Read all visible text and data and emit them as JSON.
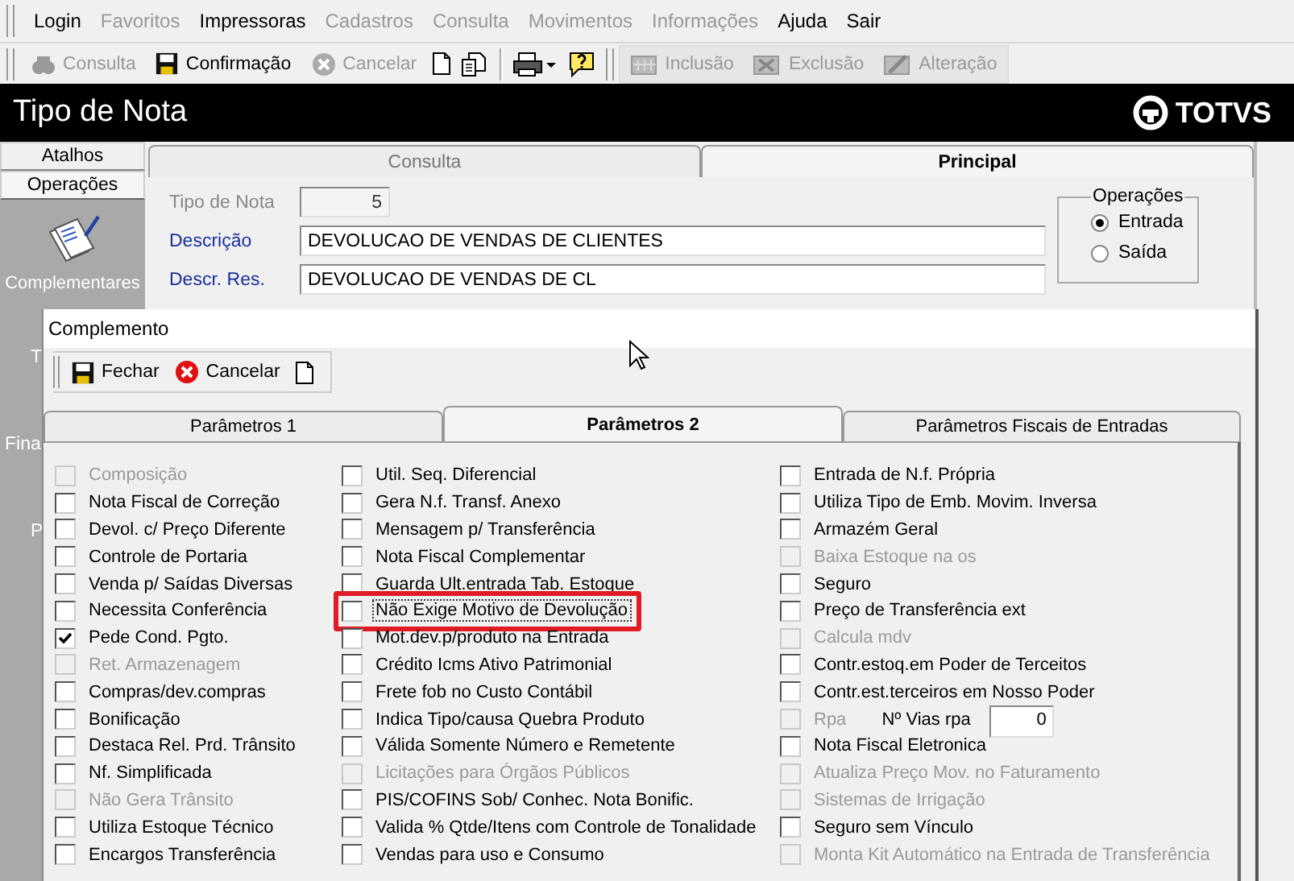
{
  "menu": [
    {
      "label": "Login",
      "disabled": false
    },
    {
      "label": "Favoritos",
      "disabled": true
    },
    {
      "label": "Impressoras",
      "disabled": false
    },
    {
      "label": "Cadastros",
      "disabled": true
    },
    {
      "label": "Consulta",
      "disabled": true
    },
    {
      "label": "Movimentos",
      "disabled": true
    },
    {
      "label": "Informações",
      "disabled": true
    },
    {
      "label": "Ajuda",
      "disabled": false
    },
    {
      "label": "Sair",
      "disabled": false
    }
  ],
  "toolbar": [
    {
      "kind": "button",
      "label": "Consulta",
      "disabled": true
    },
    {
      "kind": "button",
      "label": "Confirmação",
      "disabled": false
    },
    {
      "kind": "button",
      "label": "Cancelar",
      "disabled": true
    },
    {
      "kind": "icon"
    },
    {
      "kind": "icon"
    },
    {
      "kind": "separator"
    },
    {
      "kind": "icon"
    },
    {
      "kind": "icon"
    },
    {
      "kind": "separator"
    },
    {
      "kind": "button",
      "label": "Inclusão",
      "disabled": true
    },
    {
      "kind": "button",
      "label": "Exclusão",
      "disabled": true
    },
    {
      "kind": "button",
      "label": "Alteração",
      "disabled": true
    }
  ],
  "window": {
    "title": "Tipo de Nota",
    "logo": "TOTVS"
  },
  "sidebar": {
    "tabs": [
      {
        "label": "Atalhos",
        "selected": false
      },
      {
        "label": "Operações",
        "selected": true
      }
    ],
    "items": [
      {
        "kind": "icon_item",
        "label": "Complementares"
      },
      {
        "kind": "text",
        "label": "T"
      },
      {
        "kind": "text",
        "label": "Fina"
      },
      {
        "kind": "text",
        "label": "P"
      }
    ]
  },
  "main_tabs": [
    {
      "label": "Consulta",
      "selected": false
    },
    {
      "label": "Principal",
      "selected": true
    }
  ],
  "form": {
    "fields": [
      {
        "label": "Tipo de Nota",
        "value": "5",
        "disabled": true
      },
      {
        "label": "Descrição",
        "value": "DEVOLUCAO DE VENDAS DE CLIENTES",
        "disabled": false
      },
      {
        "label": "Descr. Res.",
        "value": "DEVOLUCAO DE VENDAS DE CL",
        "disabled": false
      }
    ],
    "operations": {
      "title": "Operações",
      "options": [
        {
          "label": "Entrada",
          "selected": true
        },
        {
          "label": "Saída",
          "selected": false
        }
      ]
    }
  },
  "dialog": {
    "title": "Complemento",
    "toolbar": [
      "Fechar",
      "Cancelar"
    ],
    "tabs": [
      {
        "label": "Parâmetros 1",
        "selected": false
      },
      {
        "label": "Parâmetros 2",
        "selected": true
      },
      {
        "label": "Parâmetros Fiscais de Entradas",
        "selected": false
      }
    ],
    "columns": [
      [
        {
          "label": "Composição",
          "checked": false,
          "disabled": true
        },
        {
          "label": "Nota Fiscal de Correção",
          "checked": false,
          "disabled": false
        },
        {
          "label": "Devol. c/ Preço Diferente",
          "checked": false,
          "disabled": false
        },
        {
          "label": "Controle de Portaria",
          "checked": false,
          "disabled": false
        },
        {
          "label": "Venda p/ Saídas Diversas",
          "checked": false,
          "disabled": false
        },
        {
          "label": "Necessita Conferência",
          "checked": false,
          "disabled": false
        },
        {
          "label": "Pede Cond. Pgto.",
          "checked": true,
          "disabled": false
        },
        {
          "label": "Ret. Armazenagem",
          "checked": false,
          "disabled": true
        },
        {
          "label": "Compras/dev.compras",
          "checked": false,
          "disabled": false
        },
        {
          "label": "Bonificação",
          "checked": false,
          "disabled": false
        },
        {
          "label": "Destaca Rel. Prd. Trânsito",
          "checked": false,
          "disabled": false
        },
        {
          "label": "Nf. Simplificada",
          "checked": false,
          "disabled": false
        },
        {
          "label": "Não Gera Trânsito",
          "checked": false,
          "disabled": true
        },
        {
          "label": "Utiliza Estoque Técnico",
          "checked": false,
          "disabled": false
        },
        {
          "label": "Encargos Transferência",
          "checked": false,
          "disabled": false
        }
      ],
      [
        {
          "label": "Util. Seq. Diferencial",
          "checked": false,
          "disabled": false
        },
        {
          "label": "Gera N.f. Transf. Anexo",
          "checked": false,
          "disabled": false
        },
        {
          "label": "Mensagem p/ Transferência",
          "checked": false,
          "disabled": false
        },
        {
          "label": "Nota Fiscal Complementar",
          "checked": false,
          "disabled": false
        },
        {
          "label": "Guarda Ult.entrada Tab. Estoque",
          "checked": false,
          "disabled": false
        },
        {
          "label": "Não Exige Motivo de Devolução",
          "checked": false,
          "disabled": false,
          "highlighted": true
        },
        {
          "label": "Mot.dev.p/produto na Entrada",
          "checked": false,
          "disabled": false
        },
        {
          "label": "Crédito Icms Ativo Patrimonial",
          "checked": false,
          "disabled": false
        },
        {
          "label": "Frete fob no Custo Contábil",
          "checked": false,
          "disabled": false
        },
        {
          "label": "Indica Tipo/causa Quebra Produto",
          "checked": false,
          "disabled": false
        },
        {
          "label": "Válida Somente Número e Remetente",
          "checked": false,
          "disabled": false
        },
        {
          "label": "Licitações para Órgãos Públicos",
          "checked": false,
          "disabled": true
        },
        {
          "label": "PIS/COFINS Sob/ Conhec. Nota Bonific.",
          "checked": false,
          "disabled": false
        },
        {
          "label": "Valida % Qtde/Itens com Controle de Tonalidade",
          "checked": false,
          "disabled": false
        },
        {
          "label": "Vendas para uso e Consumo",
          "checked": false,
          "disabled": false
        }
      ],
      [
        {
          "label": "Entrada de N.f. Própria",
          "checked": false,
          "disabled": false
        },
        {
          "label": "Utiliza Tipo de Emb. Movim. Inversa",
          "checked": false,
          "disabled": false
        },
        {
          "label": "Armazém Geral",
          "checked": false,
          "disabled": false
        },
        {
          "label": "Baixa Estoque na os",
          "checked": false,
          "disabled": true
        },
        {
          "label": "Seguro",
          "checked": false,
          "disabled": false
        },
        {
          "label": "Preço de Transferência ext",
          "checked": false,
          "disabled": false
        },
        {
          "label": "Calcula mdv",
          "checked": false,
          "disabled": true
        },
        {
          "label": "Contr.estoq.em Poder de Terceitos",
          "checked": false,
          "disabled": false
        },
        {
          "label": "Contr.est.terceiros em Nosso Poder",
          "checked": false,
          "disabled": false
        },
        {
          "kind": "with_field",
          "label": "Rpa",
          "checked": false,
          "disabled": true,
          "field_label": "Nº Vias rpa",
          "field_value": "0"
        },
        {
          "label": "Nota Fiscal Eletronica",
          "checked": false,
          "disabled": false
        },
        {
          "label": "Atualiza Preço Mov. no Faturamento",
          "checked": false,
          "disabled": true
        },
        {
          "label": "Sistemas de Irrigação",
          "checked": false,
          "disabled": true
        },
        {
          "label": "Seguro sem Vínculo",
          "checked": false,
          "disabled": false
        },
        {
          "label": "Monta Kit Automático na Entrada de Transferência",
          "checked": false,
          "disabled": true
        }
      ]
    ]
  }
}
